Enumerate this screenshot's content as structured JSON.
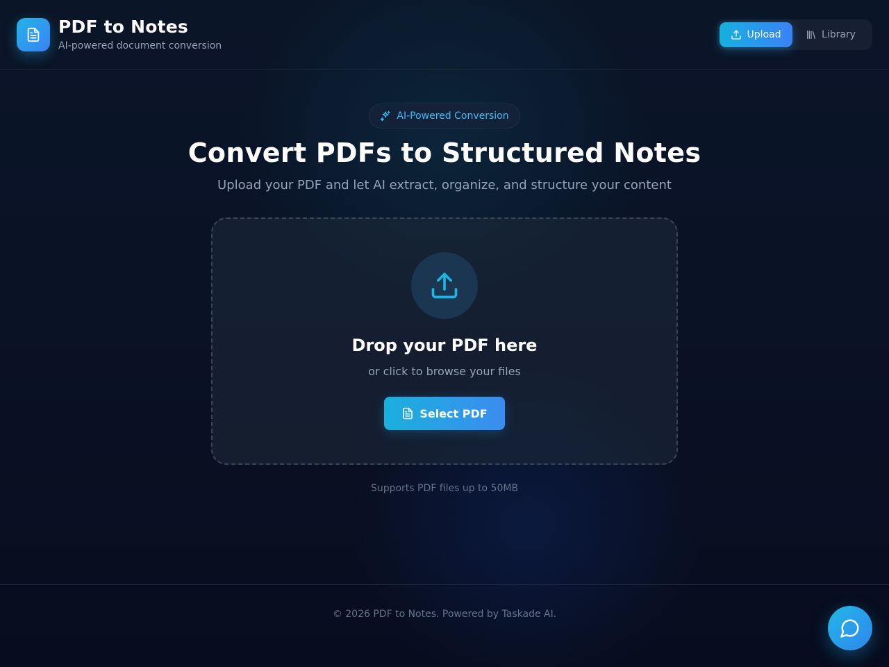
{
  "header": {
    "title": "PDF to Notes",
    "subtitle": "AI-powered document conversion",
    "logo_icon": "document-icon",
    "nav": [
      {
        "label": "Upload",
        "icon": "upload-icon",
        "active": true
      },
      {
        "label": "Library",
        "icon": "library-icon",
        "active": false
      }
    ]
  },
  "hero": {
    "badge": "AI-Powered Conversion",
    "badge_icon": "sparkles-icon",
    "title": "Convert PDFs to Structured Notes",
    "subtitle": "Upload your PDF and let AI extract, organize, and structure your content"
  },
  "dropzone": {
    "icon": "upload-icon",
    "title": "Drop your PDF here",
    "subtitle": "or click to browse your files",
    "button_label": "Select PDF",
    "button_icon": "document-icon",
    "note": "Supports PDF files up to 50MB"
  },
  "footer": {
    "text": "© 2026 PDF to Notes. Powered by Taskade AI."
  },
  "chat": {
    "icon": "chat-bubble-icon"
  },
  "colors": {
    "accent": "#22b4e6",
    "accent_end": "#3b82f6",
    "background": "#0b1528",
    "muted_text": "#94a3b8"
  }
}
